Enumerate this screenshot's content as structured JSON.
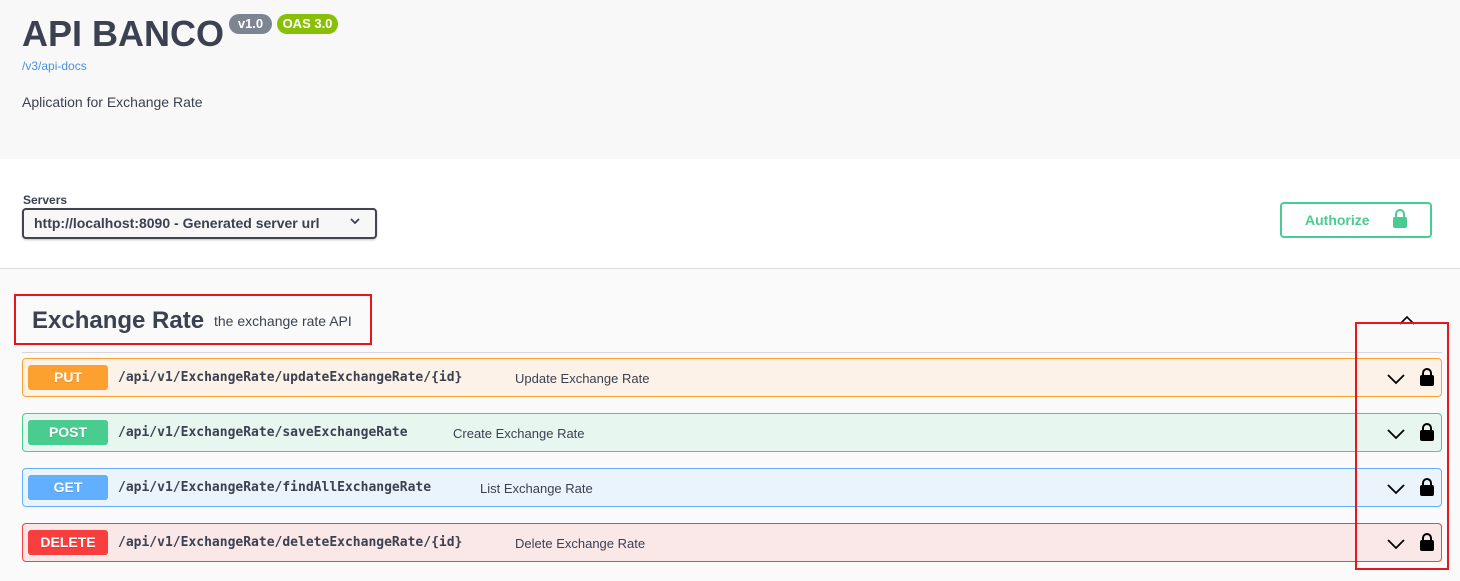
{
  "info": {
    "title": "API BANCO",
    "version_badge": "v1.0",
    "oas_badge": "OAS 3.0",
    "spec_link": "/v3/api-docs",
    "description": "Aplication for Exchange Rate"
  },
  "servers": {
    "label": "Servers",
    "selected": "http://localhost:8090 - Generated server url"
  },
  "authorize": {
    "label": "Authorize"
  },
  "tag": {
    "name": "Exchange Rate",
    "description": "the exchange rate API"
  },
  "operations": [
    {
      "method": "PUT",
      "path": "/api/v1/ExchangeRate/updateExchangeRate/{id}",
      "summary": "Update Exchange Rate"
    },
    {
      "method": "POST",
      "path": "/api/v1/ExchangeRate/saveExchangeRate",
      "summary": "Create Exchange Rate"
    },
    {
      "method": "GET",
      "path": "/api/v1/ExchangeRate/findAllExchangeRate",
      "summary": "List Exchange Rate"
    },
    {
      "method": "DELETE",
      "path": "/api/v1/ExchangeRate/deleteExchangeRate/{id}",
      "summary": "Delete Exchange Rate"
    }
  ],
  "colors": {
    "put": "#fca130",
    "post": "#49cc90",
    "get": "#61affe",
    "delete": "#f93e3e",
    "annotation": "#e8161b"
  },
  "icons": {
    "authorize": "unlocked-padlock-icon",
    "operation_lock": "locked-padlock-icon",
    "operation_expand": "chevron-down-icon",
    "tag_collapse": "chevron-up-icon",
    "server_dropdown": "chevron-down-icon"
  }
}
